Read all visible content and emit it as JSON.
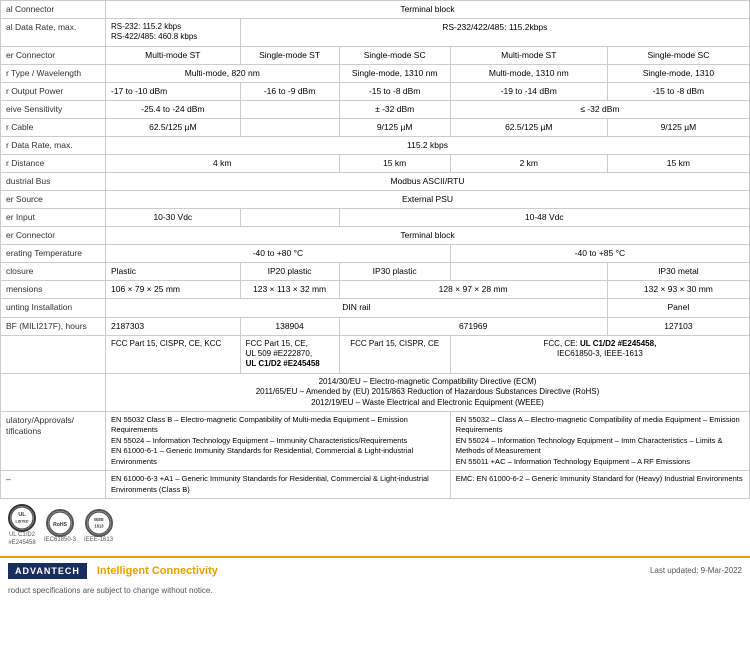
{
  "table": {
    "rows": [
      {
        "label": "al Connector",
        "cells": [
          {
            "text": "Terminal block",
            "colspan": 6,
            "center": true
          }
        ]
      },
      {
        "label": "al Data Rate, max.",
        "cells": [
          {
            "text": "RS-232: 115.2 kbps\nRS-422/485: 460.8 kbps",
            "colspan": 1
          },
          {
            "text": "RS-232/422/485: 115.2kbps",
            "colspan": 5,
            "center": true
          }
        ]
      },
      {
        "label": "er Connector",
        "cells": [
          {
            "text": "Multi-mode ST",
            "center": true
          },
          {
            "text": "Single-mode ST",
            "center": true
          },
          {
            "text": "Single-mode SC",
            "center": true
          },
          {
            "text": "Multi-mode ST",
            "center": true
          },
          {
            "text": "Single-mode SC",
            "center": true
          }
        ]
      },
      {
        "label": "r Type / Wavelength",
        "cells": [
          {
            "text": "Multi-mode, 820 nm",
            "colspan": 2,
            "center": true
          },
          {
            "text": "Single-mode, 1310 nm",
            "center": true
          },
          {
            "text": "Multi-mode, 1310 nm",
            "center": true
          },
          {
            "text": "Single-mode, 1310",
            "center": true
          }
        ]
      },
      {
        "label": "r Output Power",
        "cells": [
          {
            "text": "-17 to -10 dBm"
          },
          {
            "text": "-16 to -9 dBm",
            "center": true
          },
          {
            "text": "-15 to -8 dBm",
            "center": true
          },
          {
            "text": "-19 to -14 dBm",
            "center": true
          },
          {
            "text": "-15 to -8 dBm",
            "center": true
          }
        ]
      },
      {
        "label": "eive Sensitivity",
        "cells": [
          {
            "text": "-25.4 to -24 dBm",
            "center": true
          },
          {
            "text": "",
            "center": true
          },
          {
            "text": "± -32 dBm",
            "center": true
          },
          {
            "text": "≤ -32 dBm",
            "colspan": 2,
            "center": true
          }
        ]
      },
      {
        "label": "r Cable",
        "cells": [
          {
            "text": "62.5/125 µM",
            "center": true
          },
          {
            "text": "",
            "center": true
          },
          {
            "text": "9/125 µM",
            "center": true
          },
          {
            "text": "62.5/125 µM",
            "center": true
          },
          {
            "text": "9/125 µM",
            "center": true
          }
        ]
      },
      {
        "label": "r Data Rate, max.",
        "cells": [
          {
            "text": "115.2 kbps",
            "colspan": 5,
            "center": true
          }
        ]
      },
      {
        "label": "r Distance",
        "cells": [
          {
            "text": "4 km",
            "colspan": 2,
            "center": true
          },
          {
            "text": "15 km",
            "center": true
          },
          {
            "text": "2 km",
            "center": true
          },
          {
            "text": "15 km",
            "center": true
          }
        ]
      },
      {
        "label": "dustrial Bus",
        "cells": [
          {
            "text": "Modbus ASCII/RTU",
            "colspan": 5,
            "center": true
          }
        ]
      },
      {
        "label": "er Source",
        "cells": [
          {
            "text": "External PSU",
            "colspan": 5,
            "center": true
          }
        ]
      },
      {
        "label": "er Input",
        "cells": [
          {
            "text": "10-30 Vdc",
            "center": true
          },
          {
            "text": "",
            "center": true
          },
          {
            "text": "10-48 Vdc",
            "colspan": 3,
            "center": true
          }
        ]
      },
      {
        "label": "er Connector",
        "cells": [
          {
            "text": "Terminal block",
            "colspan": 5,
            "center": true
          }
        ]
      },
      {
        "label": "erating Temperature",
        "cells": [
          {
            "text": "-40 to +80 °C",
            "colspan": 3,
            "center": true
          },
          {
            "text": "-40 to +85 °C",
            "colspan": 2,
            "center": true
          }
        ]
      },
      {
        "label": "closure",
        "cells": [
          {
            "text": "Plastic"
          },
          {
            "text": "IP20 plastic",
            "center": true
          },
          {
            "text": "IP30 plastic",
            "center": true
          },
          {
            "text": "",
            "center": true
          },
          {
            "text": "IP30 metal",
            "center": true
          }
        ]
      },
      {
        "label": "mensions",
        "cells": [
          {
            "text": "106 × 79 × 25 mm"
          },
          {
            "text": "123 × 113 × 32 mm",
            "center": true
          },
          {
            "text": "128 × 97 × 28 mm",
            "colspan": 2,
            "center": true
          },
          {
            "text": "132 × 93 × 30 mm",
            "center": true
          }
        ]
      },
      {
        "label": "unting Installation",
        "cells": [
          {
            "text": "DIN rail",
            "colspan": 4,
            "center": true
          },
          {
            "text": "Panel",
            "center": true
          }
        ]
      },
      {
        "label": "BF (MILI217F), hours",
        "cells": [
          {
            "text": "2187303"
          },
          {
            "text": "138904",
            "center": true
          },
          {
            "text": "671969",
            "colspan": 2,
            "center": true
          },
          {
            "text": "127103",
            "center": true
          }
        ]
      },
      {
        "label": "",
        "cells": [
          {
            "text": "FCC Part 15, CISPR, CE, KCC"
          },
          {
            "text": "FCC Part 15, CE,\nUL 509 #E222870,\nUL C1/D2 #E245458",
            "bold_parts": [
              "UL C1/D2 #E245458"
            ]
          },
          {
            "text": "FCC Part 15, CISPR, CE",
            "center": true
          },
          {
            "text": "FCC, CE: UL C1/D2 #E245458,\nIEC61850-3, IEEE-1613",
            "colspan": 2,
            "center": true
          }
        ]
      }
    ],
    "regulatory_rows": [
      {
        "text": "2014/30/EU – Electro-magnetic Compatibility Directive (ECM)\n2011/65/EU – Amended by (EU) 2015/863 Reduction of Hazardous Substances Directive (RoHS)\n2012/19/EU – Waste Electrical and Electronic Equipment (WEEE)",
        "colspan": 6,
        "center": true
      }
    ],
    "regulatory_split": {
      "left": "EN 55032 Class B – Electro-magnetic Compatibility of Multi-media Equipment – Emission Requirements\nEN 55024 – Information Technology Equipment – Immunity Characteristics/Requirements\nEN 61000-6-1 – Generic Immunity Standards for Residential, Commercial & Light-industrial Environments",
      "right": "EN 55032 – Class A – Electro-magnetic Compatibility of media Equipment – Emission Requirements\nEN 55024 – Information Technology Equipment – Imm Characteristics – Limits & Methods of Measurement\nEN 55011 +AC – Information Technology Equipment – A RF Emissions"
    },
    "regulatory_bottom": {
      "left_dash": "–",
      "left_text": "EN 61000-6-3 +A1 – Generic Immunity Standards for Residential, Commercial & Light-industrial Environments (Class B)",
      "right_text": "EMC: EN 61000-6-2 – Generic Immunity Standard for (Heavy) Industrial Environments"
    }
  },
  "logos": [
    {
      "label": "UL C1/D2\n#E245458",
      "icon": "UL"
    },
    {
      "label": "IEC61850-3",
      "icon": "RoHS"
    },
    {
      "label": "IEEE-1613",
      "icon": "IEEE\n1613"
    }
  ],
  "footer": {
    "company": "ADVANTECH",
    "tagline": "Intelligent Connectivity",
    "disclaimer": "roduct specifications are subject to change without notice.",
    "last_updated": "Last updated: 9-Mar-2022"
  }
}
